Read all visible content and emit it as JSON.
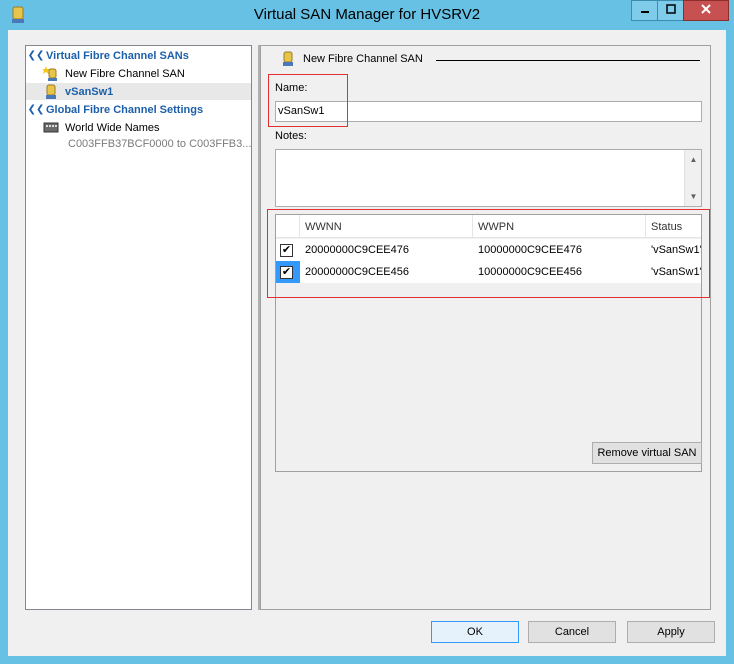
{
  "window": {
    "title": "Virtual SAN Manager for HVSRV2",
    "controls": {
      "minimize": "minimize-icon",
      "maximize": "maximize-icon",
      "close": "close-icon"
    }
  },
  "tree": {
    "section_sans": "Virtual Fibre Channel SANs",
    "item_new": "New Fibre Channel SAN",
    "item_selected": "vSanSw1",
    "section_global": "Global Fibre Channel Settings",
    "item_wwn": "World Wide Names",
    "item_wwn_sub": "C003FFB37BCF0000 to C003FFB3..."
  },
  "details": {
    "section_title": "New Fibre Channel SAN",
    "name_label": "Name:",
    "name_value": "vSanSw1",
    "notes_label": "Notes:",
    "notes_value": "",
    "columns": [
      "WWNN",
      "WWPN",
      "Status"
    ],
    "rows": [
      {
        "checked": true,
        "wwnn": "20000000C9CEE476",
        "wwpn": "10000000C9CEE476",
        "status": "'vSanSw1'"
      },
      {
        "checked": true,
        "wwnn": "20000000C9CEE456",
        "wwpn": "10000000C9CEE456",
        "status": "'vSanSw1'"
      }
    ],
    "remove_button": "Remove virtual SAN"
  },
  "footer": {
    "ok": "OK",
    "cancel": "Cancel",
    "apply": "Apply"
  },
  "colors": {
    "titlebar": "#66c1e5",
    "tree_header": "#1c5faa",
    "highlight_box": "#e03030",
    "close_button": "#c75050"
  }
}
